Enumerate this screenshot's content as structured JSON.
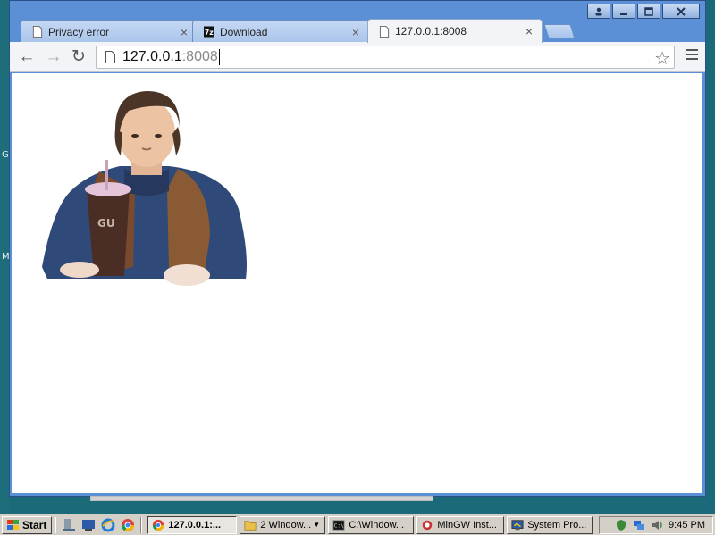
{
  "browser": {
    "tabs": [
      {
        "title": "Privacy error",
        "close": "×",
        "active": false
      },
      {
        "title": "Download",
        "close": "×",
        "active": false
      },
      {
        "title": "127.0.0.1:8008",
        "close": "×",
        "active": true
      }
    ],
    "address": {
      "host": "127.0.0.1",
      "port": ":8008"
    },
    "nav": {
      "back": "←",
      "forward": "→",
      "reload": "↻"
    },
    "star": "☆"
  },
  "page": {
    "image": "illustration-man-with-drink"
  },
  "desktop": {
    "glyph_1": "G",
    "glyph_2": "M"
  },
  "taskbar": {
    "start_label": "Start",
    "tasks": [
      {
        "label": "127.0.0.1:...",
        "icon": "chrome-icon",
        "active": true
      },
      {
        "label": "2 Window...",
        "icon": "folder-icon",
        "active": false
      },
      {
        "label": "C:\\Window...",
        "icon": "cmd-icon",
        "active": false
      },
      {
        "label": "MinGW Inst...",
        "icon": "installer-icon",
        "active": false
      },
      {
        "label": "System Pro...",
        "icon": "system-icon",
        "active": false
      }
    ],
    "group_count": "2",
    "clock": "9:45 PM"
  },
  "colors": {
    "window_frame": "#5b8fd6",
    "taskbar": "#d4d0c8",
    "desktop": "#1b6a7a"
  }
}
